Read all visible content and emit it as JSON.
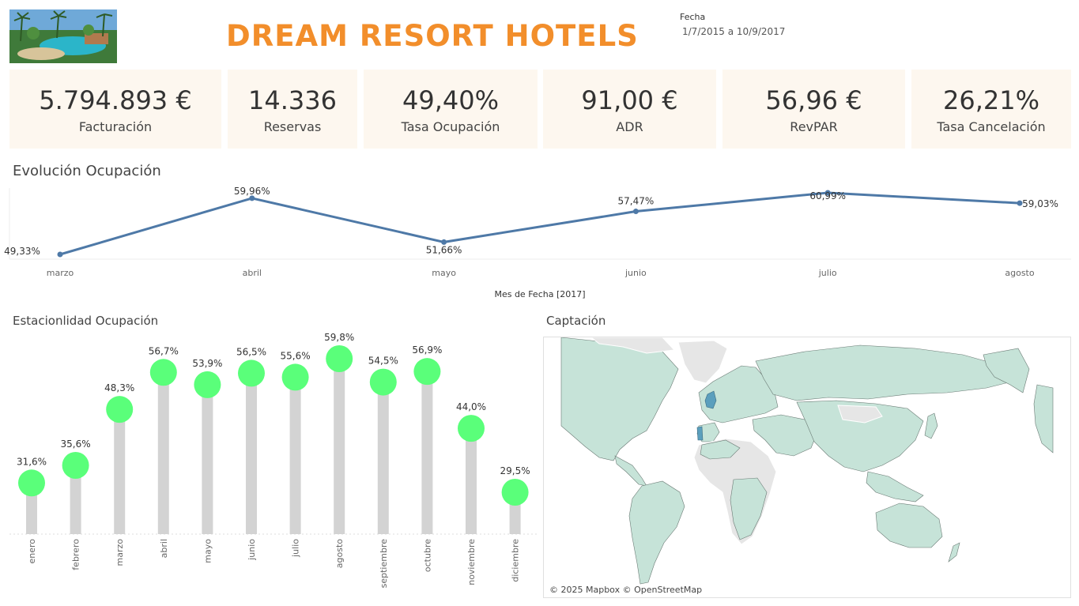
{
  "header": {
    "title": "DREAM RESORT HOTELS",
    "filter_label": "Fecha",
    "filter_value": "1/7/2015 a 10/9/2017"
  },
  "kpis": [
    {
      "value": "5.794.893 €",
      "label": "Facturación"
    },
    {
      "value": "14.336",
      "label": "Reservas"
    },
    {
      "value": "49,40%",
      "label": "Tasa Ocupación"
    },
    {
      "value": "91,00 €",
      "label": "ADR"
    },
    {
      "value": "56,96 €",
      "label": "RevPAR"
    },
    {
      "value": "26,21%",
      "label": "Tasa Cancelación"
    }
  ],
  "evolution": {
    "title": "Evolución Ocupación"
  },
  "seasonality": {
    "title": "Estacionlidad Ocupación"
  },
  "map": {
    "title": "Captación",
    "credit": "© 2025 Mapbox © OpenStreetMap"
  },
  "colors": {
    "accent": "#f28e2b",
    "line": "#4e79a7",
    "dot": "#5aff7a",
    "stem": "#d3d3d3",
    "kpi_bg": "#fdf7ef",
    "land": "#c6e3d8",
    "land_grey": "#e6e6e6",
    "highlight": "#5b9fbd"
  },
  "chart_data": [
    {
      "type": "line",
      "title": "",
      "xlabel": "Mes de Fecha [2017]",
      "ylabel": "",
      "categories": [
        "marzo",
        "abril",
        "mayo",
        "junio",
        "julio",
        "agosto"
      ],
      "values": [
        49.33,
        59.96,
        51.66,
        57.47,
        60.99,
        59.03
      ],
      "labels": [
        "49,33%",
        "59,96%",
        "51,66%",
        "57,47%",
        "60,99%",
        "59,03%"
      ],
      "grid": false
    },
    {
      "type": "bar",
      "title": "",
      "xlabel": "",
      "ylabel": "",
      "categories": [
        "enero",
        "febrero",
        "marzo",
        "abril",
        "mayo",
        "junio",
        "julio",
        "agosto",
        "septiembre",
        "octubre",
        "noviembre",
        "diciembre"
      ],
      "values": [
        31.6,
        35.6,
        48.3,
        56.7,
        53.9,
        56.5,
        55.6,
        59.8,
        54.5,
        56.9,
        44.0,
        29.5
      ],
      "labels": [
        "31,6%",
        "35,6%",
        "48,3%",
        "56,7%",
        "53,9%",
        "56,5%",
        "55,6%",
        "59,8%",
        "54,5%",
        "56,9%",
        "44,0%",
        "29,5%"
      ],
      "ylim": [
        0,
        60
      ],
      "grid": false
    }
  ]
}
